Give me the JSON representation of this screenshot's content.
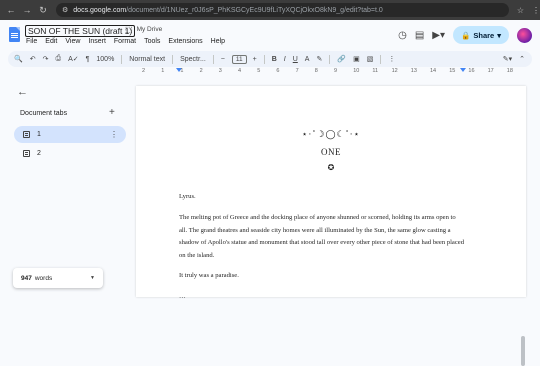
{
  "browser": {
    "url_host": "docs.google.com",
    "url_path": "/document/d/1NUez_r0J6sP_PhKSGCyEc9U9fLiTyXQCjOkxO8kN9_g/edit?tab=t.0"
  },
  "header": {
    "title": "SON OF THE SUN (draft 1)",
    "drive_label": "My Drive",
    "menus": [
      "File",
      "Edit",
      "View",
      "Insert",
      "Format",
      "Tools",
      "Extensions",
      "Help"
    ],
    "share_label": "Share"
  },
  "toolbar": {
    "zoom": "100%",
    "style": "Normal text",
    "font": "Spectr...",
    "font_size": "11"
  },
  "ruler": {
    "numbers": [
      "2",
      "1",
      "1",
      "2",
      "3",
      "4",
      "5",
      "6",
      "7",
      "8",
      "9",
      "10",
      "11",
      "12",
      "13",
      "14",
      "15",
      "16",
      "17",
      "18"
    ]
  },
  "sidebar": {
    "title": "Document tabs",
    "tabs": [
      {
        "label": "1"
      },
      {
        "label": "2"
      }
    ],
    "word_count": "947",
    "word_count_suffix": "words"
  },
  "document": {
    "ornament": "⋆·˚☽◯☾˚·⋆",
    "chapter": "ONE",
    "symbol": "✪",
    "paragraphs": [
      "Lyrus.",
      "The melting pot of Greece and the docking place of anyone shunned or scorned, holding its arms open to all. The grand theatres and seaside city homes were all illuminated by the Sun, the same glow casting a shadow of Apollo's statue and monument that stood tall over every other piece of stone that had been placed on the island.",
      "It truly was a paradise.",
      "…"
    ]
  },
  "colors": {
    "share_bg": "#c2e7ff",
    "active_tab": "#d3e3fd",
    "doc_blue": "#4285f4"
  }
}
